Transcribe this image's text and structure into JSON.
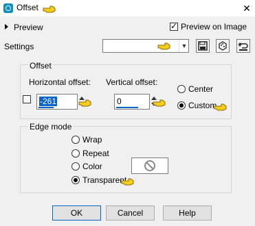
{
  "window": {
    "title": "Offset",
    "close_glyph": "✕"
  },
  "preview": {
    "label": "Preview",
    "preview_on_image_label": "Preview on Image",
    "preview_on_image_checked": true
  },
  "settings": {
    "label": "Settings",
    "value": ""
  },
  "offset_group": {
    "title": "Offset",
    "horizontal_label": "Horizontal offset:",
    "horizontal_value": "-261",
    "vertical_label": "Vertical offset:",
    "vertical_value": "0",
    "center_label": "Center",
    "custom_label": "Custom",
    "selected": "custom"
  },
  "edge_group": {
    "title": "Edge mode",
    "options": [
      "Wrap",
      "Repeat",
      "Color",
      "Transparent"
    ],
    "selected": "Transparent"
  },
  "buttons": {
    "ok": "OK",
    "cancel": "Cancel",
    "help": "Help"
  },
  "icons": [
    "app-icon",
    "pointing-hand-icon",
    "save-preset-icon",
    "randomize-dice-icon",
    "reset-arrow-icon",
    "no-entry-icon",
    "chevron-down-icon"
  ]
}
